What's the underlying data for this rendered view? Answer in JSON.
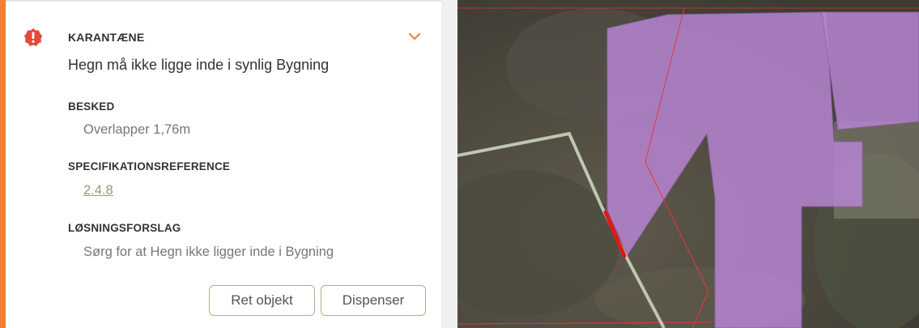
{
  "issue": {
    "severity": "KARANTÆNE",
    "title": "Hegn må ikke ligge inde i synlig Bygning",
    "message_label": "BESKED",
    "message_value": "Overlapper 1,76m",
    "spec_label": "SPECIFIKATIONSREFERENCE",
    "spec_link": "2.4.8",
    "solution_label": "LØSNINGSFORSLAG",
    "solution_value": "Sørg for at Hegn ikke ligger inde i Bygning",
    "icons": {
      "alert": "alert-icon",
      "expand": "chevron-down-icon"
    },
    "colors": {
      "accent": "#f0803a",
      "alert": "#e24a3b",
      "link": "#8da17a",
      "button_border": "#9fb88c"
    }
  },
  "actions": {
    "fix_label": "Ret objekt",
    "dispense_label": "Dispenser"
  },
  "map": {
    "building_color": "#b785d3",
    "boundary_color": "#e23a3a",
    "fence_color": "#c9d4bd",
    "conflict_color": "#e01818"
  }
}
